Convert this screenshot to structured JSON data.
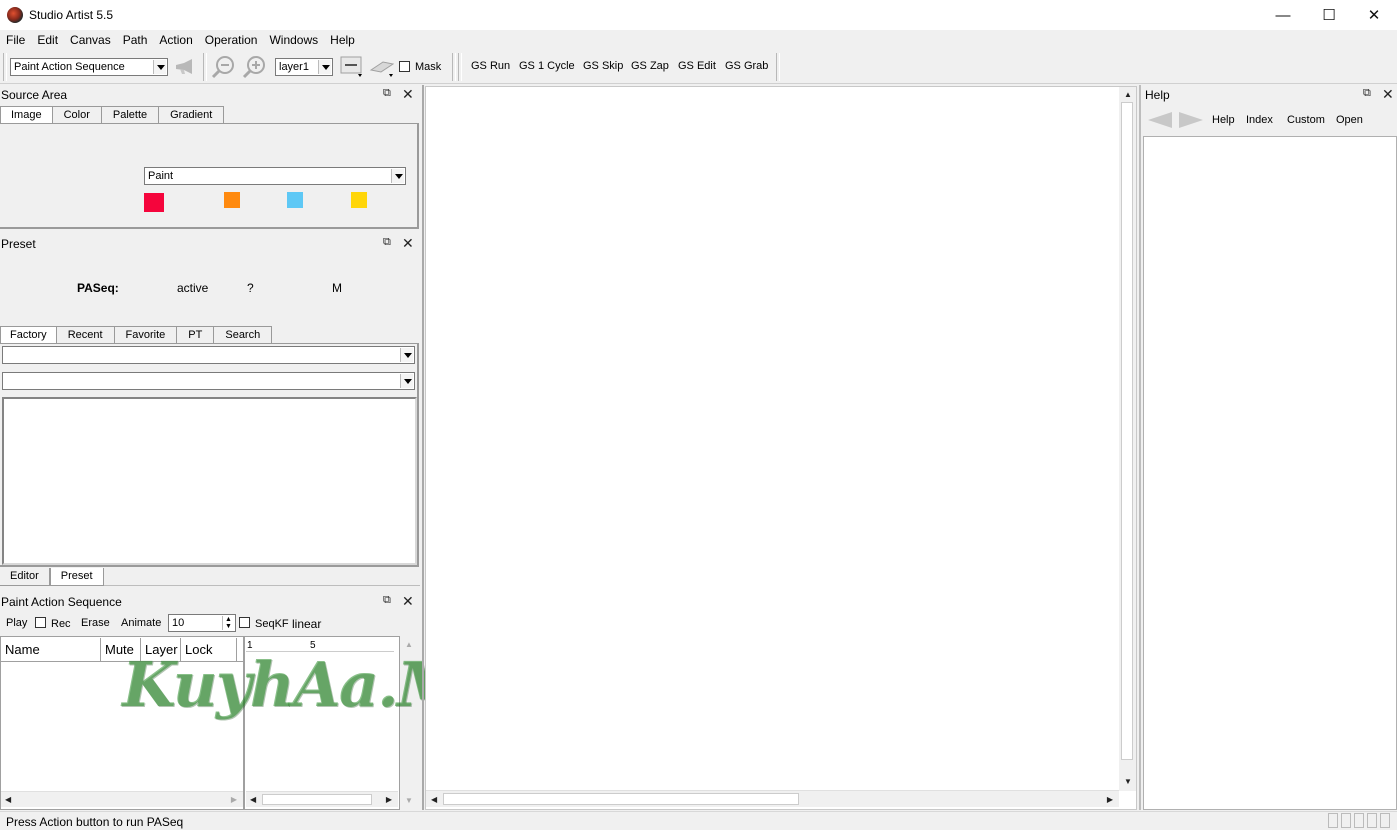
{
  "window": {
    "title": "Studio Artist 5.5",
    "minimize_glyph": "—",
    "maximize_glyph": "☐",
    "close_glyph": "✕"
  },
  "menu": [
    "File",
    "Edit",
    "Canvas",
    "Path",
    "Action",
    "Operation",
    "Windows",
    "Help"
  ],
  "toolbar": {
    "mode_select": "Paint Action Sequence",
    "layer_select": "layer1",
    "mask_label": "Mask",
    "gs_buttons": [
      "GS Run",
      "GS 1 Cycle",
      "GS Skip",
      "GS Zap",
      "GS Edit",
      "GS Grab"
    ]
  },
  "source_area": {
    "title": "Source Area",
    "tabs": [
      "Image",
      "Color",
      "Palette",
      "Gradient"
    ],
    "active_tab": "Image",
    "paint_select": "Paint",
    "swatches": [
      "#f5053c",
      "#ff8a0f",
      "#5ec8f5",
      "#ffd60a"
    ]
  },
  "preset": {
    "title": "Preset",
    "paseq_label": "PASeq:",
    "active_label": "active",
    "question_label": "?",
    "m_label": "M",
    "tabs": [
      "Factory",
      "Recent",
      "Favorite",
      "PT",
      "Search"
    ],
    "active_tab": "Factory"
  },
  "bottom_tabs": [
    "Editor",
    "Preset"
  ],
  "paseq": {
    "title": "Paint Action Sequence",
    "play": "Play",
    "rec": "Rec",
    "erase": "Erase",
    "animate": "Animate",
    "animate_value": "10",
    "seqkf": "SeqKF",
    "linear": "linear",
    "columns": [
      "Name",
      "Mute",
      "Layer",
      "Lock"
    ],
    "timeline_ticks": [
      "1",
      "5"
    ]
  },
  "help": {
    "title": "Help",
    "links": [
      "Help",
      "Index",
      "Custom",
      "Open"
    ]
  },
  "status": {
    "text": "Press Action button to run PASeq"
  },
  "watermark": "KuyhAa.Me",
  "icons": {
    "float": "⧉",
    "close": "✕"
  }
}
